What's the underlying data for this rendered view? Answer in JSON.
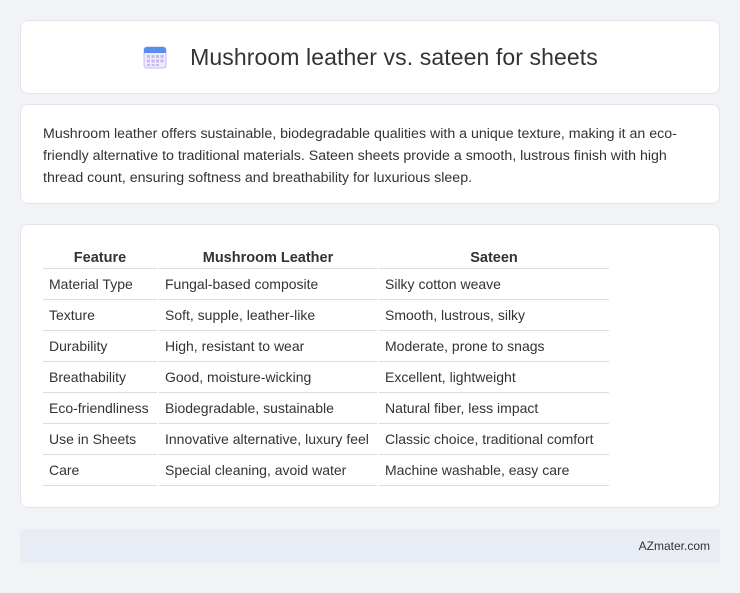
{
  "header": {
    "title": "Mushroom leather vs. sateen for sheets",
    "icon": "calendar-icon",
    "icon_colors": {
      "top": "#5b8def",
      "grid": "#c9b8f0",
      "body": "#eeeaff"
    }
  },
  "intro": {
    "text": "Mushroom leather offers sustainable, biodegradable qualities with a unique texture, making it an eco-friendly alternative to traditional materials. Sateen sheets provide a smooth, lustrous finish with high thread count, ensuring softness and breathability for luxurious sleep."
  },
  "table": {
    "headers": [
      "Feature",
      "Mushroom Leather",
      "Sateen"
    ],
    "rows": [
      [
        "Material Type",
        "Fungal-based composite",
        "Silky cotton weave"
      ],
      [
        "Texture",
        "Soft, supple, leather-like",
        "Smooth, lustrous, silky"
      ],
      [
        "Durability",
        "High, resistant to wear",
        "Moderate, prone to snags"
      ],
      [
        "Breathability",
        "Good, moisture-wicking",
        "Excellent, lightweight"
      ],
      [
        "Eco-friendliness",
        "Biodegradable, sustainable",
        "Natural fiber, less impact"
      ],
      [
        "Use in Sheets",
        "Innovative alternative, luxury feel",
        "Classic choice, traditional comfort"
      ],
      [
        "Care",
        "Special cleaning, avoid water",
        "Machine washable, easy care"
      ]
    ]
  },
  "footer": {
    "text": "AZmater.com"
  }
}
